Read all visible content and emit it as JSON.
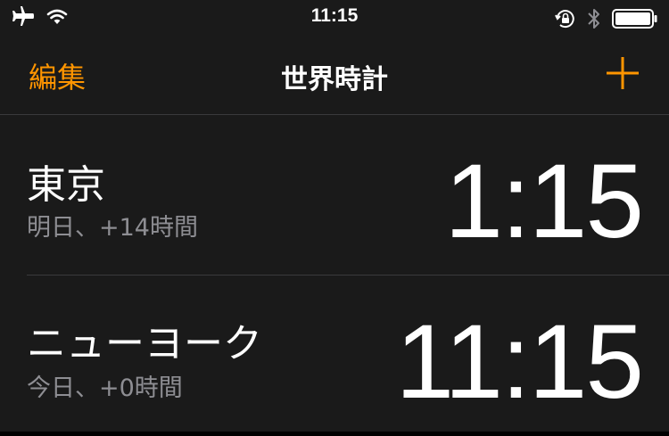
{
  "status_bar": {
    "time": "11:15",
    "icons": [
      "airplane-icon",
      "wifi-icon",
      "orientation-lock-icon",
      "bluetooth-icon",
      "battery-icon"
    ]
  },
  "nav": {
    "edit_label": "編集",
    "title": "世界時計",
    "add_icon": "plus-icon"
  },
  "colors": {
    "accent": "#ff9500",
    "background": "#1a1a1a",
    "secondary_text": "#8e8e93",
    "separator": "#3a3a3c"
  },
  "clocks": [
    {
      "city": "東京",
      "offset": "明日、+14時間",
      "time": "1:15"
    },
    {
      "city": "ニューヨーク",
      "offset": "今日、+0時間",
      "time": "11:15"
    }
  ]
}
